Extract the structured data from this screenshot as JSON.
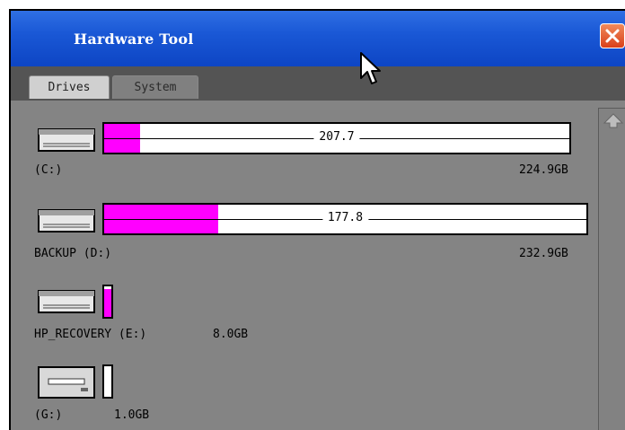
{
  "window": {
    "title": "Hardware Tool",
    "close_icon": "close-icon"
  },
  "tabs": [
    {
      "label": "Drives",
      "active": true
    },
    {
      "label": "System",
      "active": false
    }
  ],
  "drives": [
    {
      "name": "(C:)",
      "used": "207.7",
      "total": "224.9GB",
      "used_fraction": 0.077,
      "icon": "hard-drive-icon"
    },
    {
      "name": "BACKUP (D:)",
      "used": "177.8",
      "total": "232.9GB",
      "used_fraction": 0.237,
      "icon": "hard-drive-icon"
    },
    {
      "name": "HP_RECOVERY (E:)",
      "total": "8.0GB",
      "used_fraction": 0.9,
      "icon": "hard-drive-icon"
    },
    {
      "name": "(G:)",
      "total": "1.0GB",
      "used_fraction": 0.0,
      "icon": "removable-drive-icon"
    }
  ],
  "colors": {
    "titlebar": "#1a58d6",
    "usage_fill": "#ff00ff",
    "panel": "#848484"
  }
}
